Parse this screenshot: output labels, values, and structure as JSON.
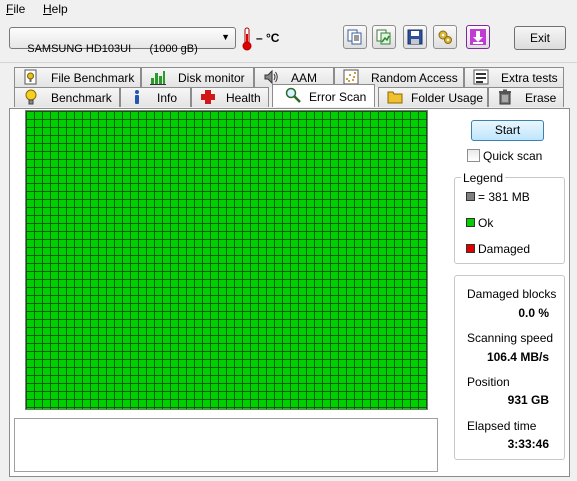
{
  "menu": {
    "file": "File",
    "help": "Help"
  },
  "toolbar": {
    "drive": "SAMSUNG HD103UI      (1000 gB)",
    "temperature": "– °C",
    "exit_label": "Exit",
    "buttons": [
      "copy-text-icon",
      "copy-image-icon",
      "save-icon",
      "options-icon",
      "download-icon"
    ]
  },
  "tabs": {
    "top": [
      "File Benchmark",
      "Disk monitor",
      "AAM",
      "Random Access",
      "Extra tests"
    ],
    "bottom": [
      "Benchmark",
      "Info",
      "Health",
      "Error Scan",
      "Folder Usage",
      "Erase"
    ],
    "active": "Error Scan"
  },
  "scan": {
    "start_label": "Start",
    "quick_scan_label": "Quick scan",
    "quick_scan_checked": false,
    "block_color_ok": "#00d000",
    "block_status": "Ok"
  },
  "legend": {
    "title": "Legend",
    "block_size": "= 381 MB",
    "ok": "Ok",
    "damaged": "Damaged",
    "colors": {
      "block": "#808080",
      "ok": "#00d000",
      "damaged": "#e00000"
    }
  },
  "stats": {
    "damaged_label": "Damaged blocks",
    "damaged_value": "0.0 %",
    "speed_label": "Scanning speed",
    "speed_value": "106.4 MB/s",
    "position_label": "Position",
    "position_value": "931 GB",
    "elapsed_label": "Elapsed time",
    "elapsed_value": "3:33:46"
  }
}
